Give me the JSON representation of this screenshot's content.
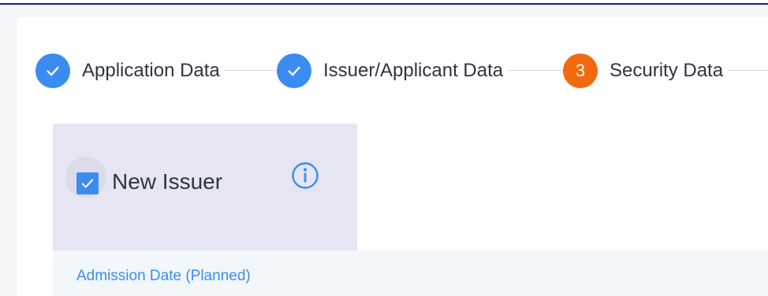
{
  "stepper": {
    "steps": [
      {
        "number": "",
        "label": "Application Data",
        "state": "completed"
      },
      {
        "number": "",
        "label": "Issuer/Applicant Data",
        "state": "completed"
      },
      {
        "number": "3",
        "label": "Security Data",
        "state": "current"
      }
    ]
  },
  "new_issuer": {
    "label": "New Issuer",
    "checked": true,
    "info_icon": "info-icon"
  },
  "admission_date": {
    "label": "Admission Date (Planned)"
  },
  "colors": {
    "accent": "#3b8cf0",
    "current_step": "#f26a10",
    "top_border": "#1a1f8f",
    "card_background": "#e6e5f4"
  }
}
